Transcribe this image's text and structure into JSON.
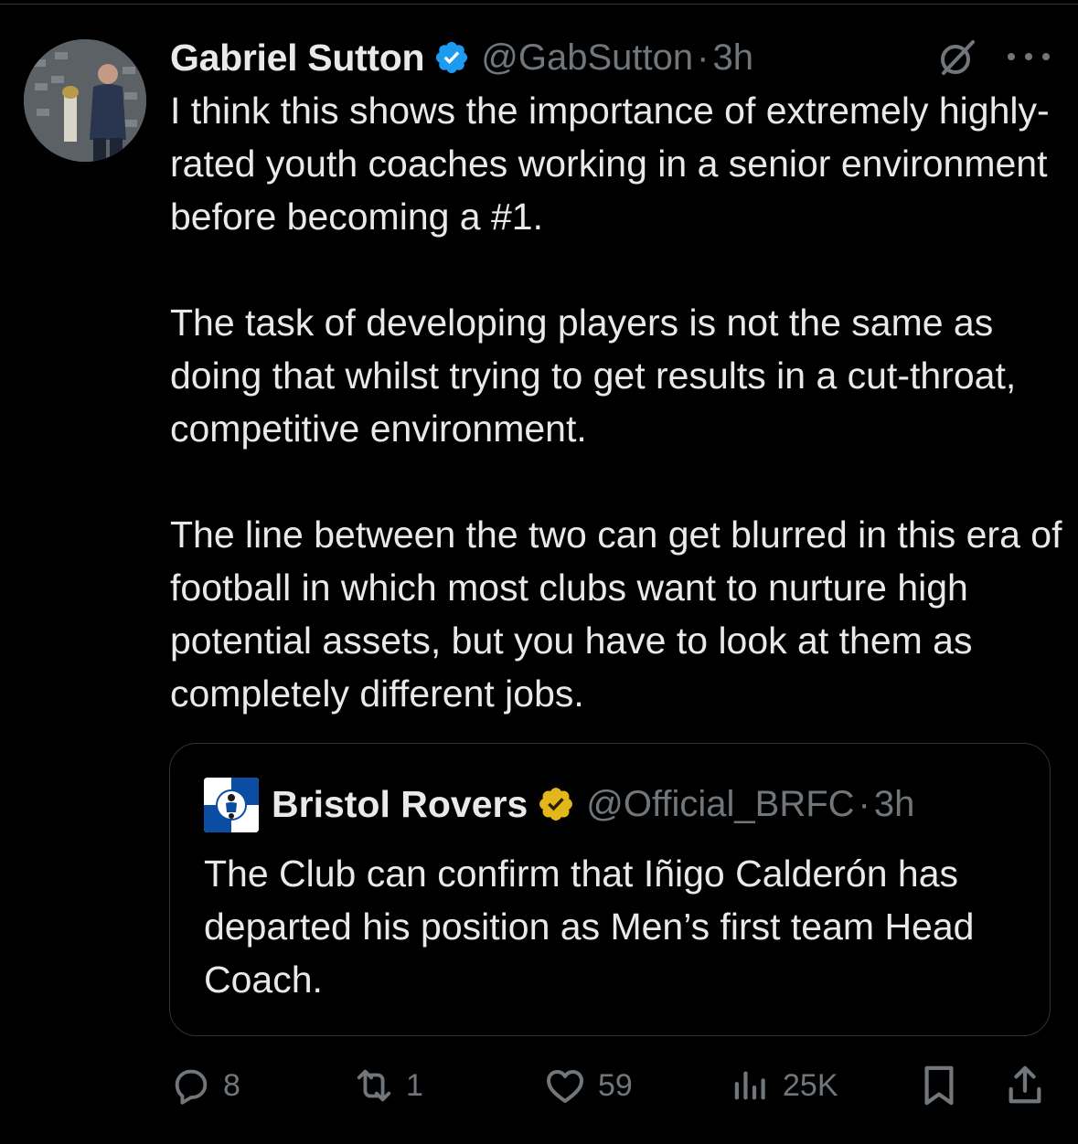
{
  "tweet": {
    "author": {
      "display_name": "Gabriel Sutton",
      "handle": "@GabSutton",
      "separator": "·",
      "time": "3h",
      "verified_badge": "blue-check-icon"
    },
    "paragraphs": [
      "I think this shows the importance of extremely highly-rated youth coaches working in a senior environment before becoming a #1.",
      "The task of developing players is not the same as doing that whilst trying to get results in a cut-throat, competitive environment.",
      "The line between the two can get blurred in this era of football in which most clubs want to nurture high potential assets, but you have to look at them as completely different jobs."
    ],
    "quoted": {
      "display_name": "Bristol Rovers",
      "handle": "@Official_BRFC",
      "separator": "·",
      "time": "3h",
      "verified_badge": "gold-check-icon",
      "text": "The Club can confirm that Iñigo Calderón has departed his position as Men’s first team Head Coach."
    },
    "actions": {
      "replies": "8",
      "reposts": "1",
      "likes": "59",
      "views": "25K"
    }
  },
  "colors": {
    "background": "#000000",
    "text_primary": "#e7e9ea",
    "text_secondary": "#71767b",
    "border": "#2f3336",
    "verified_blue": "#1d9bf0",
    "verified_gold": "#e2b719"
  },
  "icons": {
    "header_right": [
      "grok-icon",
      "more-icon"
    ],
    "actions": [
      "reply-icon",
      "repost-icon",
      "like-icon",
      "views-icon",
      "bookmark-icon",
      "share-icon"
    ]
  }
}
